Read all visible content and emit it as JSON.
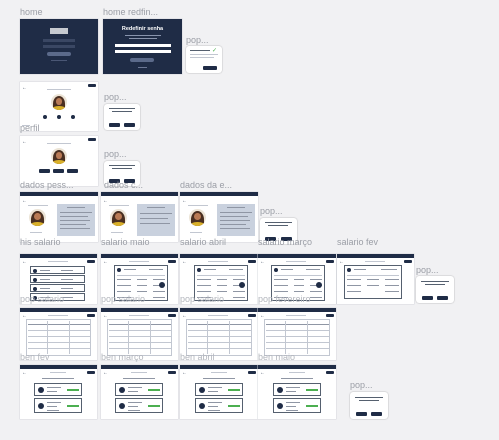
{
  "labels": {
    "home": "home",
    "home_redef": "home redfin...",
    "pop_1": "pop...",
    "perfil": "perfil",
    "pop_2": "pop...",
    "pop_3": "pop...",
    "dados_pess": "dados pess...",
    "dados_c": "dados c...",
    "dados_da_e": "dados da e...",
    "pop_4": "pop...",
    "his_salario": "his salario",
    "salario_maio": "salario maio",
    "salario_abril": "salario abril",
    "salario_marco": "salario março",
    "salario_fev": "salario fev",
    "pop_5": "pop...",
    "row4_1": "pop salario",
    "row4_2": "pop salario",
    "row4_3": "pop salario",
    "row4_4": "pop fevereiro",
    "ben_fev": "ben fev",
    "ben_marco": "ben março",
    "ben_abril": "ben abril",
    "ben_maio": "ben maio",
    "pop_6": "pop..."
  },
  "home_redefine": {
    "title": "Redefinir senha"
  },
  "colors": {
    "navy": "#1f2c46",
    "accent_green": "#4caf50",
    "canvas": "#f1f1f3"
  }
}
